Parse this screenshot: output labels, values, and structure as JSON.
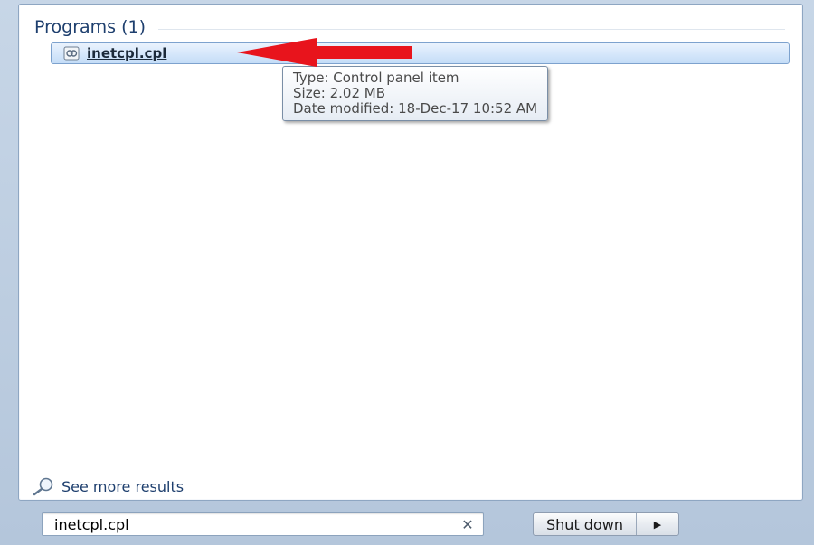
{
  "section": {
    "title": "Programs (1)"
  },
  "result": {
    "label": "inetcpl.cpl",
    "icon": "control-panel-item-icon"
  },
  "tooltip": {
    "type_line": "Type: Control panel item",
    "size_line": "Size: 2.02 MB",
    "date_line": "Date modified: 18-Dec-17 10:52 AM"
  },
  "annotation": {
    "arrow_color": "#e8141c"
  },
  "see_more": {
    "label": "See more results",
    "icon": "search-icon"
  },
  "search": {
    "value": "inetcpl.cpl",
    "clear_glyph": "✕"
  },
  "shutdown": {
    "label": "Shut down",
    "arrow_glyph": "▶"
  }
}
